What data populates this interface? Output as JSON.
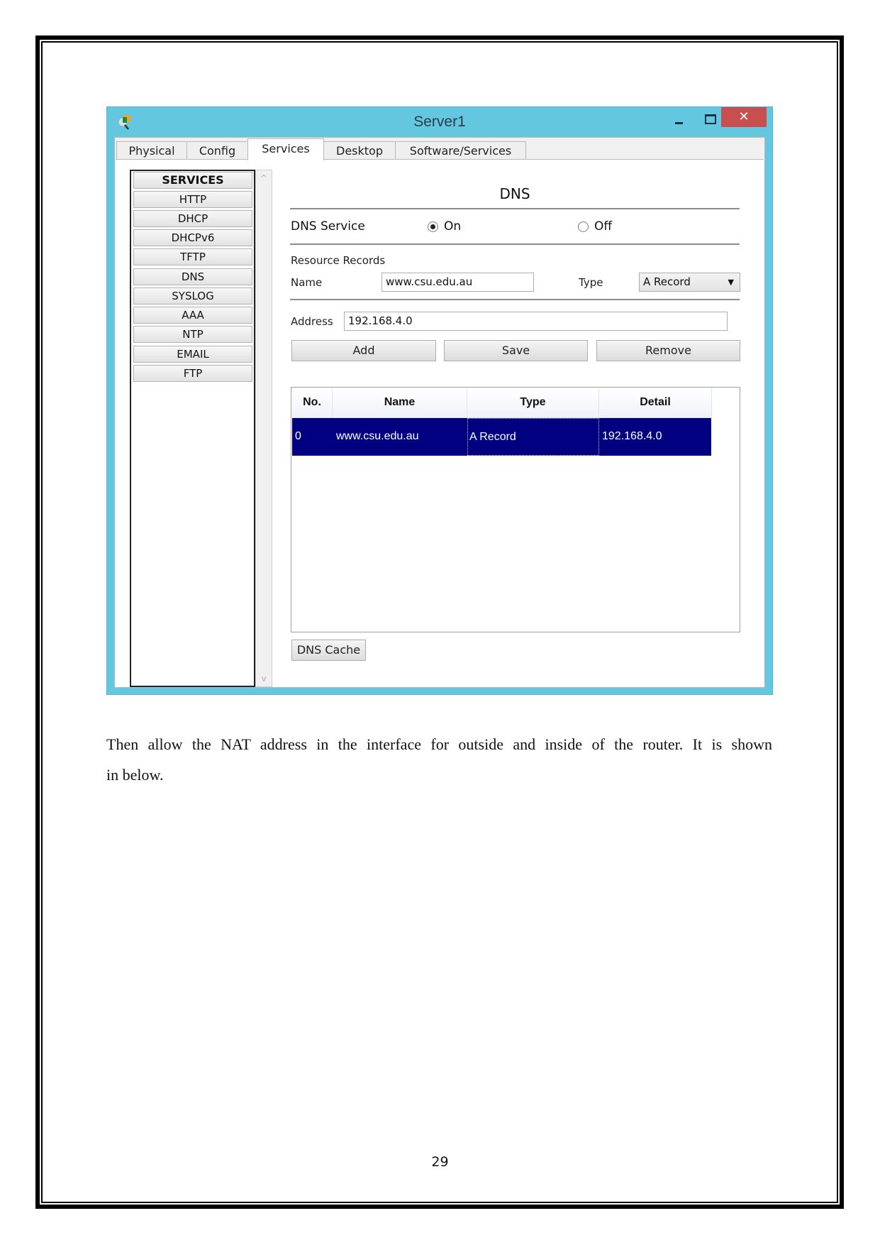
{
  "window": {
    "title": "Server1",
    "app_icon": "magnifier-device-icon",
    "controls": {
      "minimize": "–",
      "maximize": "□",
      "close": "✕"
    },
    "colors": {
      "titlebar": "#63c7df",
      "close": "#c94f4f",
      "selection": "#000080"
    }
  },
  "tabs": [
    {
      "label": "Physical",
      "active": false
    },
    {
      "label": "Config",
      "active": false
    },
    {
      "label": "Services",
      "active": true
    },
    {
      "label": "Desktop",
      "active": false
    },
    {
      "label": "Software/Services",
      "active": false
    }
  ],
  "services": {
    "header": "SERVICES",
    "items": [
      "HTTP",
      "DHCP",
      "DHCPv6",
      "TFTP",
      "DNS",
      "SYSLOG",
      "AAA",
      "NTP",
      "EMAIL",
      "FTP"
    ],
    "scroll_up": "^",
    "scroll_down": "v"
  },
  "dns": {
    "title": "DNS",
    "service_label": "DNS Service",
    "on_label": "On",
    "off_label": "Off",
    "service_state": "On",
    "resource_records_label": "Resource Records",
    "name_label": "Name",
    "name_value": "www.csu.edu.au",
    "type_label": "Type",
    "type_value": "A Record",
    "address_label": "Address",
    "address_value": "192.168.4.0",
    "buttons": {
      "add": "Add",
      "save": "Save",
      "remove": "Remove",
      "dns_cache": "DNS Cache"
    },
    "table": {
      "columns": [
        "No.",
        "Name",
        "Type",
        "Detail"
      ],
      "rows": [
        {
          "no": "0",
          "name": "www.csu.edu.au",
          "type": "A Record",
          "detail": "192.168.4.0",
          "selected": true
        }
      ]
    }
  },
  "document": {
    "paragraph_line1": "Then allow the NAT address in the interface for outside and inside of the router. It is shown",
    "paragraph_line2": "in below.",
    "page_number": "29"
  }
}
